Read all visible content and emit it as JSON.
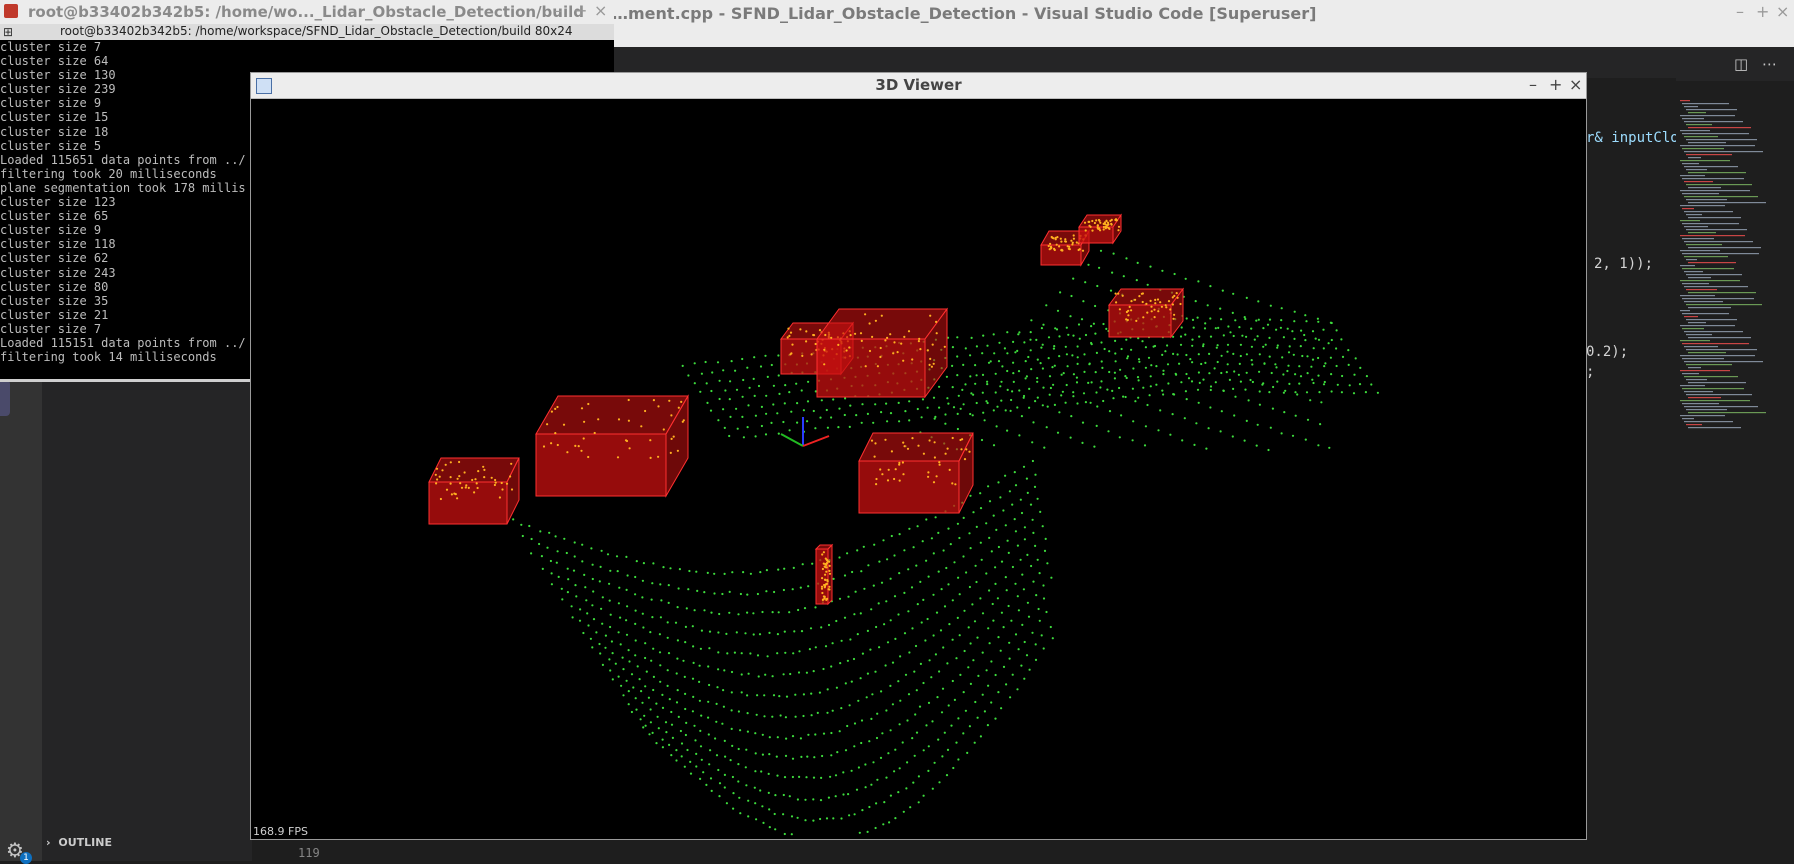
{
  "vscode": {
    "title": "…ment.cpp - SFND_Lidar_Obstacle_Detection - Visual Studio Code [Superuser]",
    "editor_fragments": [
      "r& inputClo",
      "2, 1));",
      "0.2);",
      ";"
    ],
    "outline_label": "OUTLINE",
    "line_number": "119",
    "settings_badge": "1"
  },
  "terminal": {
    "title": "root@b33402b342b5: /home/wo..._Lidar_Obstacle_Detection/build",
    "tab_label": "root@b33402b342b5: /home/workspace/SFND_Lidar_Obstacle_Detection/build 80x24",
    "lines": [
      "cluster size 7",
      "cluster size 64",
      "cluster size 130",
      "cluster size 239",
      "cluster size 9",
      "cluster size 15",
      "cluster size 18",
      "cluster size 5",
      "Loaded 115651 data points from ../",
      "filtering took 20 milliseconds",
      "plane segmentation took 178 millis",
      "cluster size 123",
      "cluster size 65",
      "cluster size 9",
      "cluster size 118",
      "cluster size 62",
      "cluster size 243",
      "cluster size 80",
      "cluster size 35",
      "cluster size 21",
      "cluster size 7",
      "Loaded 115151 data points from ../",
      "filtering took 14 milliseconds"
    ]
  },
  "viewer": {
    "title": "3D Viewer",
    "fps": "168.9 FPS",
    "colors": {
      "road_points": "#3ddc3d",
      "obstacle_points": "#ffb020",
      "box_fill": "#c81010",
      "box_edge": "#ff3030"
    }
  },
  "icons": {
    "minimize": "–",
    "maximize": "+",
    "close": "×"
  }
}
